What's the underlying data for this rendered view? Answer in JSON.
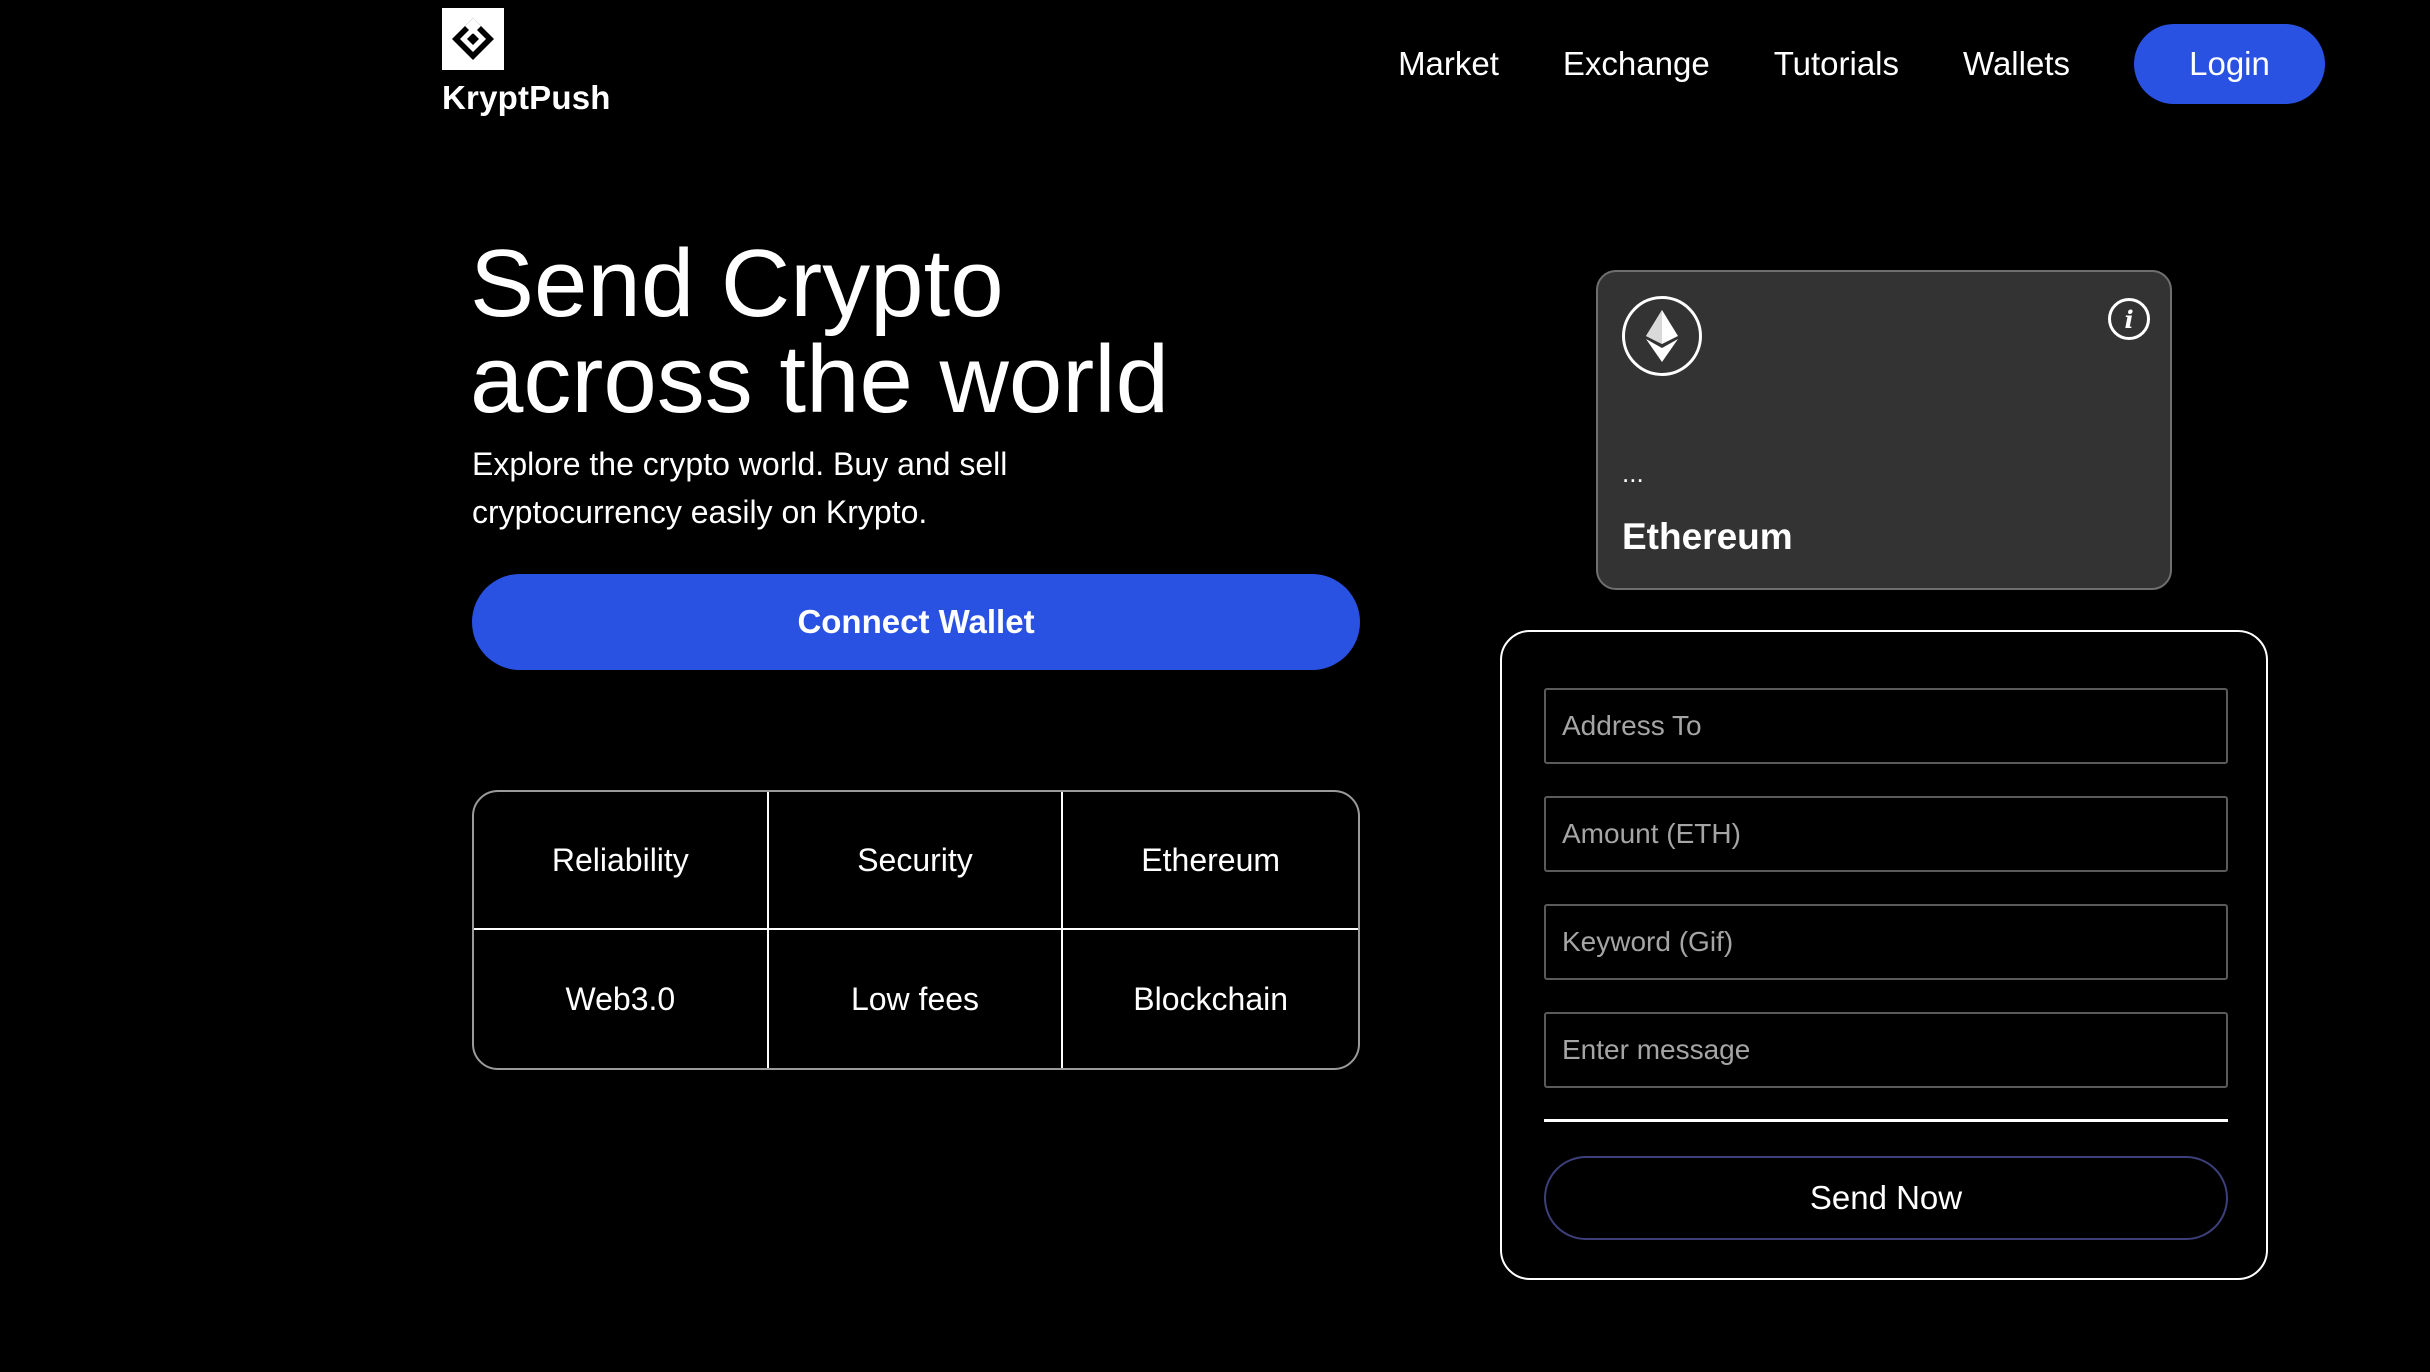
{
  "header": {
    "brand": "KryptPush",
    "logo_icon": "kryptpush-logo-icon",
    "nav": [
      {
        "label": "Market"
      },
      {
        "label": "Exchange"
      },
      {
        "label": "Tutorials"
      },
      {
        "label": "Wallets"
      }
    ],
    "login_label": "Login"
  },
  "hero": {
    "title_line1": "Send Crypto",
    "title_line2": "across the world",
    "subtitle": "Explore the crypto world. Buy and sell cryptocurrency easily on Krypto.",
    "connect_label": "Connect Wallet"
  },
  "features": [
    "Reliability",
    "Security",
    "Ethereum",
    "Web3.0",
    "Low fees",
    "Blockchain"
  ],
  "eth_card": {
    "icon": "ethereum-icon",
    "info_icon": "info-icon",
    "address": "...",
    "network": "Ethereum"
  },
  "form": {
    "address_placeholder": "Address To",
    "amount_placeholder": "Amount (ETH)",
    "keyword_placeholder": "Keyword (Gif)",
    "message_placeholder": "Enter message",
    "send_label": "Send Now"
  },
  "colors": {
    "background": "#000000",
    "accent": "#2952e3",
    "card": "#333333",
    "send_border": "#3c3f79"
  }
}
